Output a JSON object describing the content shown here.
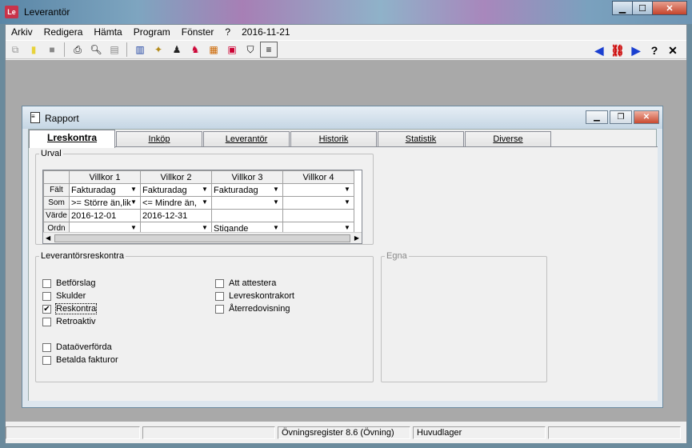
{
  "app": {
    "title": "Leverantör",
    "icon_text": "Le",
    "window_buttons": [
      "minimize",
      "maximize",
      "close"
    ]
  },
  "menu": {
    "items": [
      "Arkiv",
      "Redigera",
      "Hämta",
      "Program",
      "Fönster",
      "?",
      "2016-11-21"
    ]
  },
  "toolbar": {
    "icons": [
      "copy-icon",
      "new-icon",
      "stop-icon",
      "print-icon",
      "print-preview-icon",
      "document-icon",
      "chart-icon",
      "magic-icon",
      "person-icon",
      "person-edit-icon",
      "clipboard-icon",
      "calculator-icon",
      "filter-icon",
      "report-icon"
    ],
    "right_icons": [
      "prev-icon",
      "find-icon",
      "next-icon",
      "help-icon",
      "close-icon"
    ],
    "right_glyphs": [
      "◀",
      "⛓",
      "▶",
      "?",
      "✕"
    ]
  },
  "child": {
    "title": "Rapport"
  },
  "tabs": [
    "Lreskontra",
    "Inköp",
    "Leverantör",
    "Historik",
    "Statistik",
    "Diverse"
  ],
  "urval": {
    "legend": "Urval",
    "columns": [
      "Villkor 1",
      "Villkor 2",
      "Villkor 3",
      "Villkor 4"
    ],
    "row_headers": [
      "Fält",
      "Som",
      "Värde",
      "Ordn"
    ],
    "rows": [
      [
        "Fakturadag",
        "Fakturadag",
        "Fakturadag",
        ""
      ],
      [
        ">= Större än,lik",
        "<= Mindre än,",
        "",
        ""
      ],
      [
        "2016-12-01",
        "2016-12-31",
        "",
        ""
      ],
      [
        "",
        "",
        "Stigande",
        ""
      ]
    ]
  },
  "lev": {
    "legend": "Leverantörsreskontra",
    "left": [
      {
        "label": "Betförslag",
        "checked": false
      },
      {
        "label": "Skulder",
        "checked": false
      },
      {
        "label": "Reskontra",
        "checked": true
      },
      {
        "label": "Retroaktiv",
        "checked": false
      },
      {
        "label": "Dataöverförda",
        "checked": false
      },
      {
        "label": "Betalda fakturor",
        "checked": false
      }
    ],
    "right": [
      {
        "label": "Att attestera",
        "checked": false
      },
      {
        "label": "Levreskontrakort",
        "checked": false
      },
      {
        "label": "Återredovisning",
        "checked": false
      }
    ]
  },
  "egna": {
    "legend": "Egna"
  },
  "status": {
    "cells": [
      "",
      "",
      "Övningsregister  8.6 (Övning)",
      "Huvudlager",
      ""
    ]
  }
}
